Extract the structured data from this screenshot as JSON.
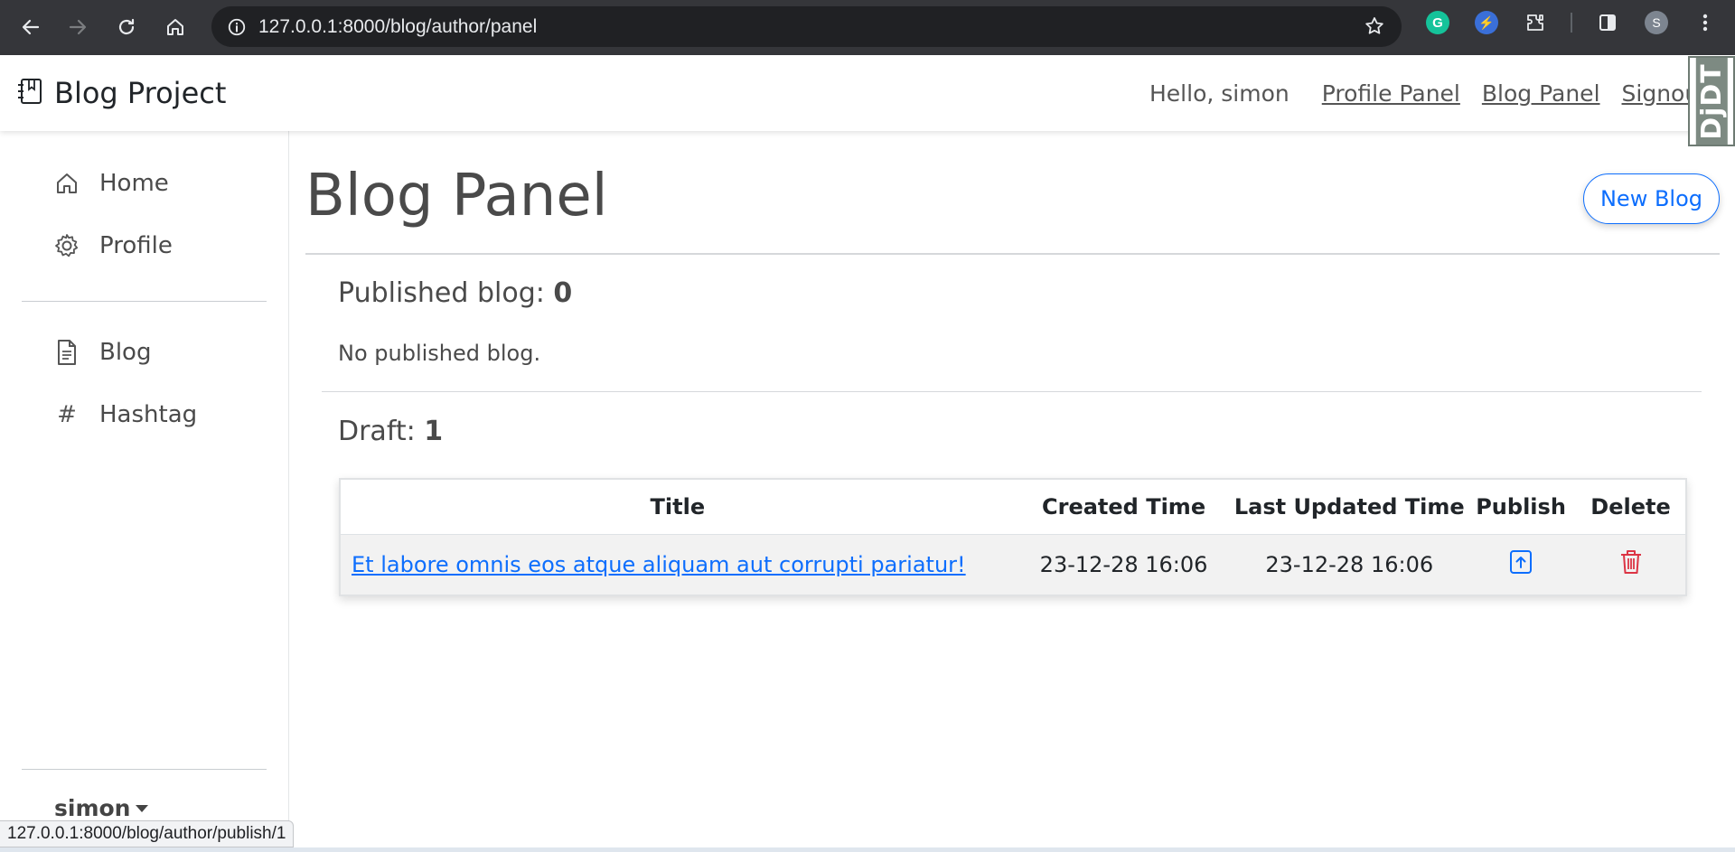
{
  "browser": {
    "url": "127.0.0.1:8000/blog/author/panel",
    "profile_initial": "S",
    "status_url": "127.0.0.1:8000/blog/author/publish/1"
  },
  "navbar": {
    "brand": "Blog Project",
    "greeting": "Hello, simon",
    "links": [
      "Profile Panel",
      "Blog Panel",
      "Signout"
    ],
    "debug_toolbar": "DjDT"
  },
  "sidebar": {
    "items": [
      {
        "label": "Home",
        "icon": "home-icon"
      },
      {
        "label": "Profile",
        "icon": "gear-icon"
      },
      {
        "label": "Blog",
        "icon": "document-icon"
      },
      {
        "label": "Hashtag",
        "icon": "hash-icon"
      }
    ],
    "user": "simon"
  },
  "main": {
    "title": "Blog Panel",
    "new_blog_label": "New Blog",
    "published_label": "Published blog: ",
    "published_count": "0",
    "published_empty": "No published blog.",
    "draft_label": "Draft: ",
    "draft_count": "1",
    "table": {
      "headers": [
        "Title",
        "Created Time",
        "Last Updated Time",
        "Publish",
        "Delete"
      ],
      "rows": [
        {
          "title": "Et labore omnis eos atque aliquam aut corrupti pariatur!",
          "created": "23-12-28 16:06",
          "updated": "23-12-28 16:06"
        }
      ]
    }
  },
  "colors": {
    "accent": "#0d6efd",
    "danger": "#dc3545",
    "chrome": "#35363a"
  }
}
